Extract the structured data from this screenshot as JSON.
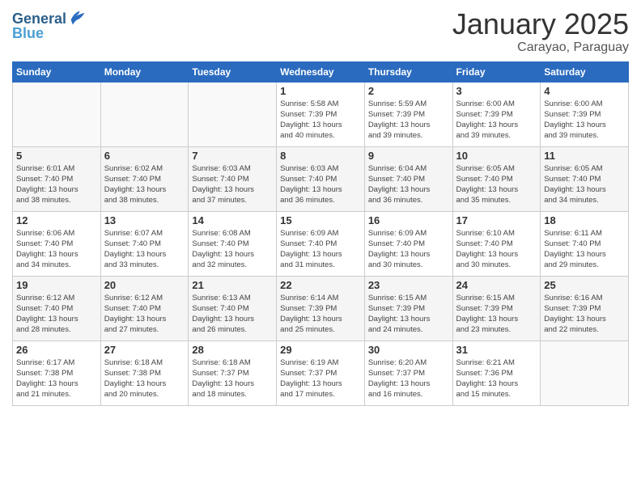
{
  "logo": {
    "line1": "General",
    "line2": "Blue"
  },
  "title": "January 2025",
  "subtitle": "Carayao, Paraguay",
  "days_of_week": [
    "Sunday",
    "Monday",
    "Tuesday",
    "Wednesday",
    "Thursday",
    "Friday",
    "Saturday"
  ],
  "weeks": [
    [
      {
        "day": "",
        "info": ""
      },
      {
        "day": "",
        "info": ""
      },
      {
        "day": "",
        "info": ""
      },
      {
        "day": "1",
        "info": "Sunrise: 5:58 AM\nSunset: 7:39 PM\nDaylight: 13 hours\nand 40 minutes."
      },
      {
        "day": "2",
        "info": "Sunrise: 5:59 AM\nSunset: 7:39 PM\nDaylight: 13 hours\nand 39 minutes."
      },
      {
        "day": "3",
        "info": "Sunrise: 6:00 AM\nSunset: 7:39 PM\nDaylight: 13 hours\nand 39 minutes."
      },
      {
        "day": "4",
        "info": "Sunrise: 6:00 AM\nSunset: 7:39 PM\nDaylight: 13 hours\nand 39 minutes."
      }
    ],
    [
      {
        "day": "5",
        "info": "Sunrise: 6:01 AM\nSunset: 7:40 PM\nDaylight: 13 hours\nand 38 minutes."
      },
      {
        "day": "6",
        "info": "Sunrise: 6:02 AM\nSunset: 7:40 PM\nDaylight: 13 hours\nand 38 minutes."
      },
      {
        "day": "7",
        "info": "Sunrise: 6:03 AM\nSunset: 7:40 PM\nDaylight: 13 hours\nand 37 minutes."
      },
      {
        "day": "8",
        "info": "Sunrise: 6:03 AM\nSunset: 7:40 PM\nDaylight: 13 hours\nand 36 minutes."
      },
      {
        "day": "9",
        "info": "Sunrise: 6:04 AM\nSunset: 7:40 PM\nDaylight: 13 hours\nand 36 minutes."
      },
      {
        "day": "10",
        "info": "Sunrise: 6:05 AM\nSunset: 7:40 PM\nDaylight: 13 hours\nand 35 minutes."
      },
      {
        "day": "11",
        "info": "Sunrise: 6:05 AM\nSunset: 7:40 PM\nDaylight: 13 hours\nand 34 minutes."
      }
    ],
    [
      {
        "day": "12",
        "info": "Sunrise: 6:06 AM\nSunset: 7:40 PM\nDaylight: 13 hours\nand 34 minutes."
      },
      {
        "day": "13",
        "info": "Sunrise: 6:07 AM\nSunset: 7:40 PM\nDaylight: 13 hours\nand 33 minutes."
      },
      {
        "day": "14",
        "info": "Sunrise: 6:08 AM\nSunset: 7:40 PM\nDaylight: 13 hours\nand 32 minutes."
      },
      {
        "day": "15",
        "info": "Sunrise: 6:09 AM\nSunset: 7:40 PM\nDaylight: 13 hours\nand 31 minutes."
      },
      {
        "day": "16",
        "info": "Sunrise: 6:09 AM\nSunset: 7:40 PM\nDaylight: 13 hours\nand 30 minutes."
      },
      {
        "day": "17",
        "info": "Sunrise: 6:10 AM\nSunset: 7:40 PM\nDaylight: 13 hours\nand 30 minutes."
      },
      {
        "day": "18",
        "info": "Sunrise: 6:11 AM\nSunset: 7:40 PM\nDaylight: 13 hours\nand 29 minutes."
      }
    ],
    [
      {
        "day": "19",
        "info": "Sunrise: 6:12 AM\nSunset: 7:40 PM\nDaylight: 13 hours\nand 28 minutes."
      },
      {
        "day": "20",
        "info": "Sunrise: 6:12 AM\nSunset: 7:40 PM\nDaylight: 13 hours\nand 27 minutes."
      },
      {
        "day": "21",
        "info": "Sunrise: 6:13 AM\nSunset: 7:40 PM\nDaylight: 13 hours\nand 26 minutes."
      },
      {
        "day": "22",
        "info": "Sunrise: 6:14 AM\nSunset: 7:39 PM\nDaylight: 13 hours\nand 25 minutes."
      },
      {
        "day": "23",
        "info": "Sunrise: 6:15 AM\nSunset: 7:39 PM\nDaylight: 13 hours\nand 24 minutes."
      },
      {
        "day": "24",
        "info": "Sunrise: 6:15 AM\nSunset: 7:39 PM\nDaylight: 13 hours\nand 23 minutes."
      },
      {
        "day": "25",
        "info": "Sunrise: 6:16 AM\nSunset: 7:39 PM\nDaylight: 13 hours\nand 22 minutes."
      }
    ],
    [
      {
        "day": "26",
        "info": "Sunrise: 6:17 AM\nSunset: 7:38 PM\nDaylight: 13 hours\nand 21 minutes."
      },
      {
        "day": "27",
        "info": "Sunrise: 6:18 AM\nSunset: 7:38 PM\nDaylight: 13 hours\nand 20 minutes."
      },
      {
        "day": "28",
        "info": "Sunrise: 6:18 AM\nSunset: 7:37 PM\nDaylight: 13 hours\nand 18 minutes."
      },
      {
        "day": "29",
        "info": "Sunrise: 6:19 AM\nSunset: 7:37 PM\nDaylight: 13 hours\nand 17 minutes."
      },
      {
        "day": "30",
        "info": "Sunrise: 6:20 AM\nSunset: 7:37 PM\nDaylight: 13 hours\nand 16 minutes."
      },
      {
        "day": "31",
        "info": "Sunrise: 6:21 AM\nSunset: 7:36 PM\nDaylight: 13 hours\nand 15 minutes."
      },
      {
        "day": "",
        "info": ""
      }
    ]
  ]
}
